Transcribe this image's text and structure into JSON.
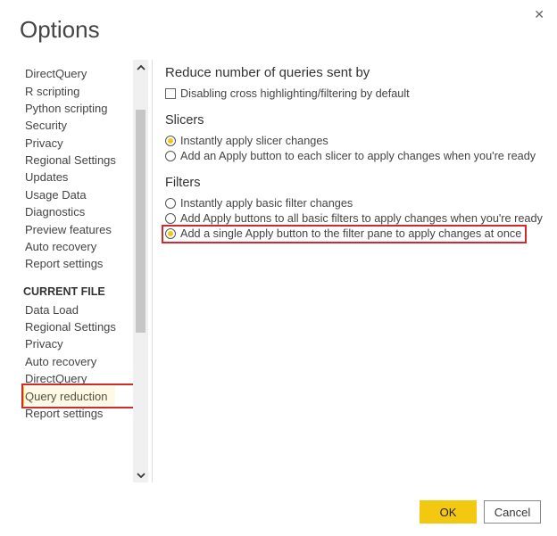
{
  "title": "Options",
  "sidebar": {
    "global_items": [
      "DirectQuery",
      "R scripting",
      "Python scripting",
      "Security",
      "Privacy",
      "Regional Settings",
      "Updates",
      "Usage Data",
      "Diagnostics",
      "Preview features",
      "Auto recovery",
      "Report settings"
    ],
    "current_heading": "CURRENT FILE",
    "current_items": [
      "Data Load",
      "Regional Settings",
      "Privacy",
      "Auto recovery",
      "DirectQuery",
      "Query reduction",
      "Report settings"
    ],
    "selected": "Query reduction"
  },
  "content": {
    "sect1_title": "Reduce number of queries sent by",
    "sect1_chk1": "Disabling cross highlighting/filtering by default",
    "slicers_title": "Slicers",
    "slicer_opt1": "Instantly apply slicer changes",
    "slicer_opt2": "Add an Apply button to each slicer to apply changes when you're ready",
    "filters_title": "Filters",
    "filter_opt1": "Instantly apply basic filter changes",
    "filter_opt2": "Add Apply buttons to all basic filters to apply changes when you're ready",
    "filter_opt3": "Add a single Apply button to the filter pane to apply changes at once"
  },
  "buttons": {
    "ok": "OK",
    "cancel": "Cancel"
  }
}
